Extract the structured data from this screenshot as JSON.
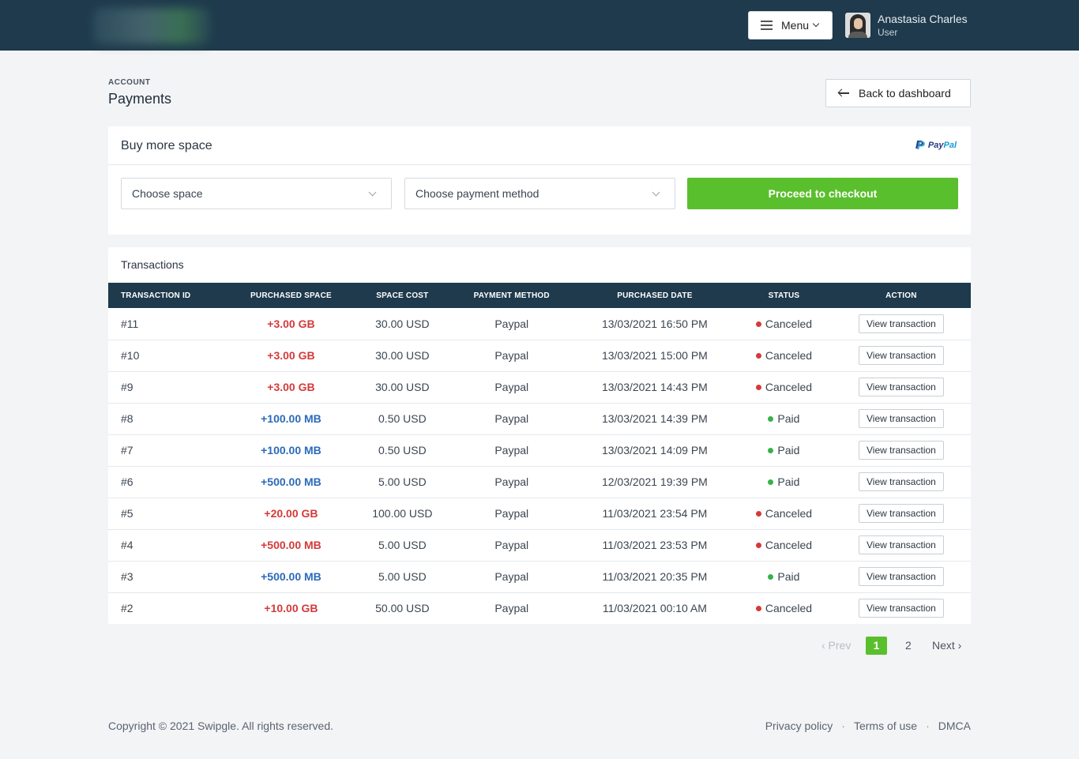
{
  "header": {
    "menu_label": "Menu",
    "user": {
      "name": "Anastasia Charles",
      "role": "User"
    }
  },
  "page": {
    "eyebrow": "ACCOUNT",
    "title": "Payments",
    "back_label": "Back to dashboard"
  },
  "buy": {
    "title": "Buy more space",
    "paypal": {
      "pay": "Pay",
      "pal": "Pal"
    },
    "space_select": "Choose space",
    "method_select": "Choose payment method",
    "checkout_label": "Proceed to checkout"
  },
  "transactions": {
    "title": "Transactions",
    "columns": [
      "TRANSACTION ID",
      "PURCHASED SPACE",
      "SPACE COST",
      "PAYMENT METHOD",
      "PURCHASED DATE",
      "STATUS",
      "ACTION"
    ],
    "rows": [
      {
        "id": "#11",
        "space": "+3.00 GB",
        "space_color": "red",
        "cost": "30.00 USD",
        "method": "Paypal",
        "date": "13/03/2021 16:50 PM",
        "status": "Canceled",
        "action": "View transaction"
      },
      {
        "id": "#10",
        "space": "+3.00 GB",
        "space_color": "red",
        "cost": "30.00 USD",
        "method": "Paypal",
        "date": "13/03/2021 15:00 PM",
        "status": "Canceled",
        "action": "View transaction"
      },
      {
        "id": "#9",
        "space": "+3.00 GB",
        "space_color": "red",
        "cost": "30.00 USD",
        "method": "Paypal",
        "date": "13/03/2021 14:43 PM",
        "status": "Canceled",
        "action": "View transaction"
      },
      {
        "id": "#8",
        "space": "+100.00 MB",
        "space_color": "blue",
        "cost": "0.50 USD",
        "method": "Paypal",
        "date": "13/03/2021 14:39 PM",
        "status": "Paid",
        "action": "View transaction"
      },
      {
        "id": "#7",
        "space": "+100.00 MB",
        "space_color": "blue",
        "cost": "0.50 USD",
        "method": "Paypal",
        "date": "13/03/2021 14:09 PM",
        "status": "Paid",
        "action": "View transaction"
      },
      {
        "id": "#6",
        "space": "+500.00 MB",
        "space_color": "blue",
        "cost": "5.00 USD",
        "method": "Paypal",
        "date": "12/03/2021 19:39 PM",
        "status": "Paid",
        "action": "View transaction"
      },
      {
        "id": "#5",
        "space": "+20.00 GB",
        "space_color": "red",
        "cost": "100.00 USD",
        "method": "Paypal",
        "date": "11/03/2021 23:54 PM",
        "status": "Canceled",
        "action": "View transaction"
      },
      {
        "id": "#4",
        "space": "+500.00 MB",
        "space_color": "red",
        "cost": "5.00 USD",
        "method": "Paypal",
        "date": "11/03/2021 23:53 PM",
        "status": "Canceled",
        "action": "View transaction"
      },
      {
        "id": "#3",
        "space": "+500.00 MB",
        "space_color": "blue",
        "cost": "5.00 USD",
        "method": "Paypal",
        "date": "11/03/2021 20:35 PM",
        "status": "Paid",
        "action": "View transaction"
      },
      {
        "id": "#2",
        "space": "+10.00 GB",
        "space_color": "red",
        "cost": "50.00 USD",
        "method": "Paypal",
        "date": "11/03/2021 00:10 AM",
        "status": "Canceled",
        "action": "View transaction"
      }
    ]
  },
  "pagination": {
    "prev": "‹ Prev",
    "pages": [
      "1",
      "2"
    ],
    "current": "1",
    "next": "Next ›"
  },
  "footer": {
    "copyright": "Copyright © 2021 Swipgle. All rights reserved.",
    "links": [
      "Privacy policy",
      "Terms of use",
      "DMCA"
    ],
    "separator": "·"
  },
  "colors": {
    "navbar": "#1e3a4c",
    "accent_green": "#5abf2d",
    "red": "#d43a3a",
    "blue": "#2c6ab8",
    "paid": "#36b24a"
  }
}
